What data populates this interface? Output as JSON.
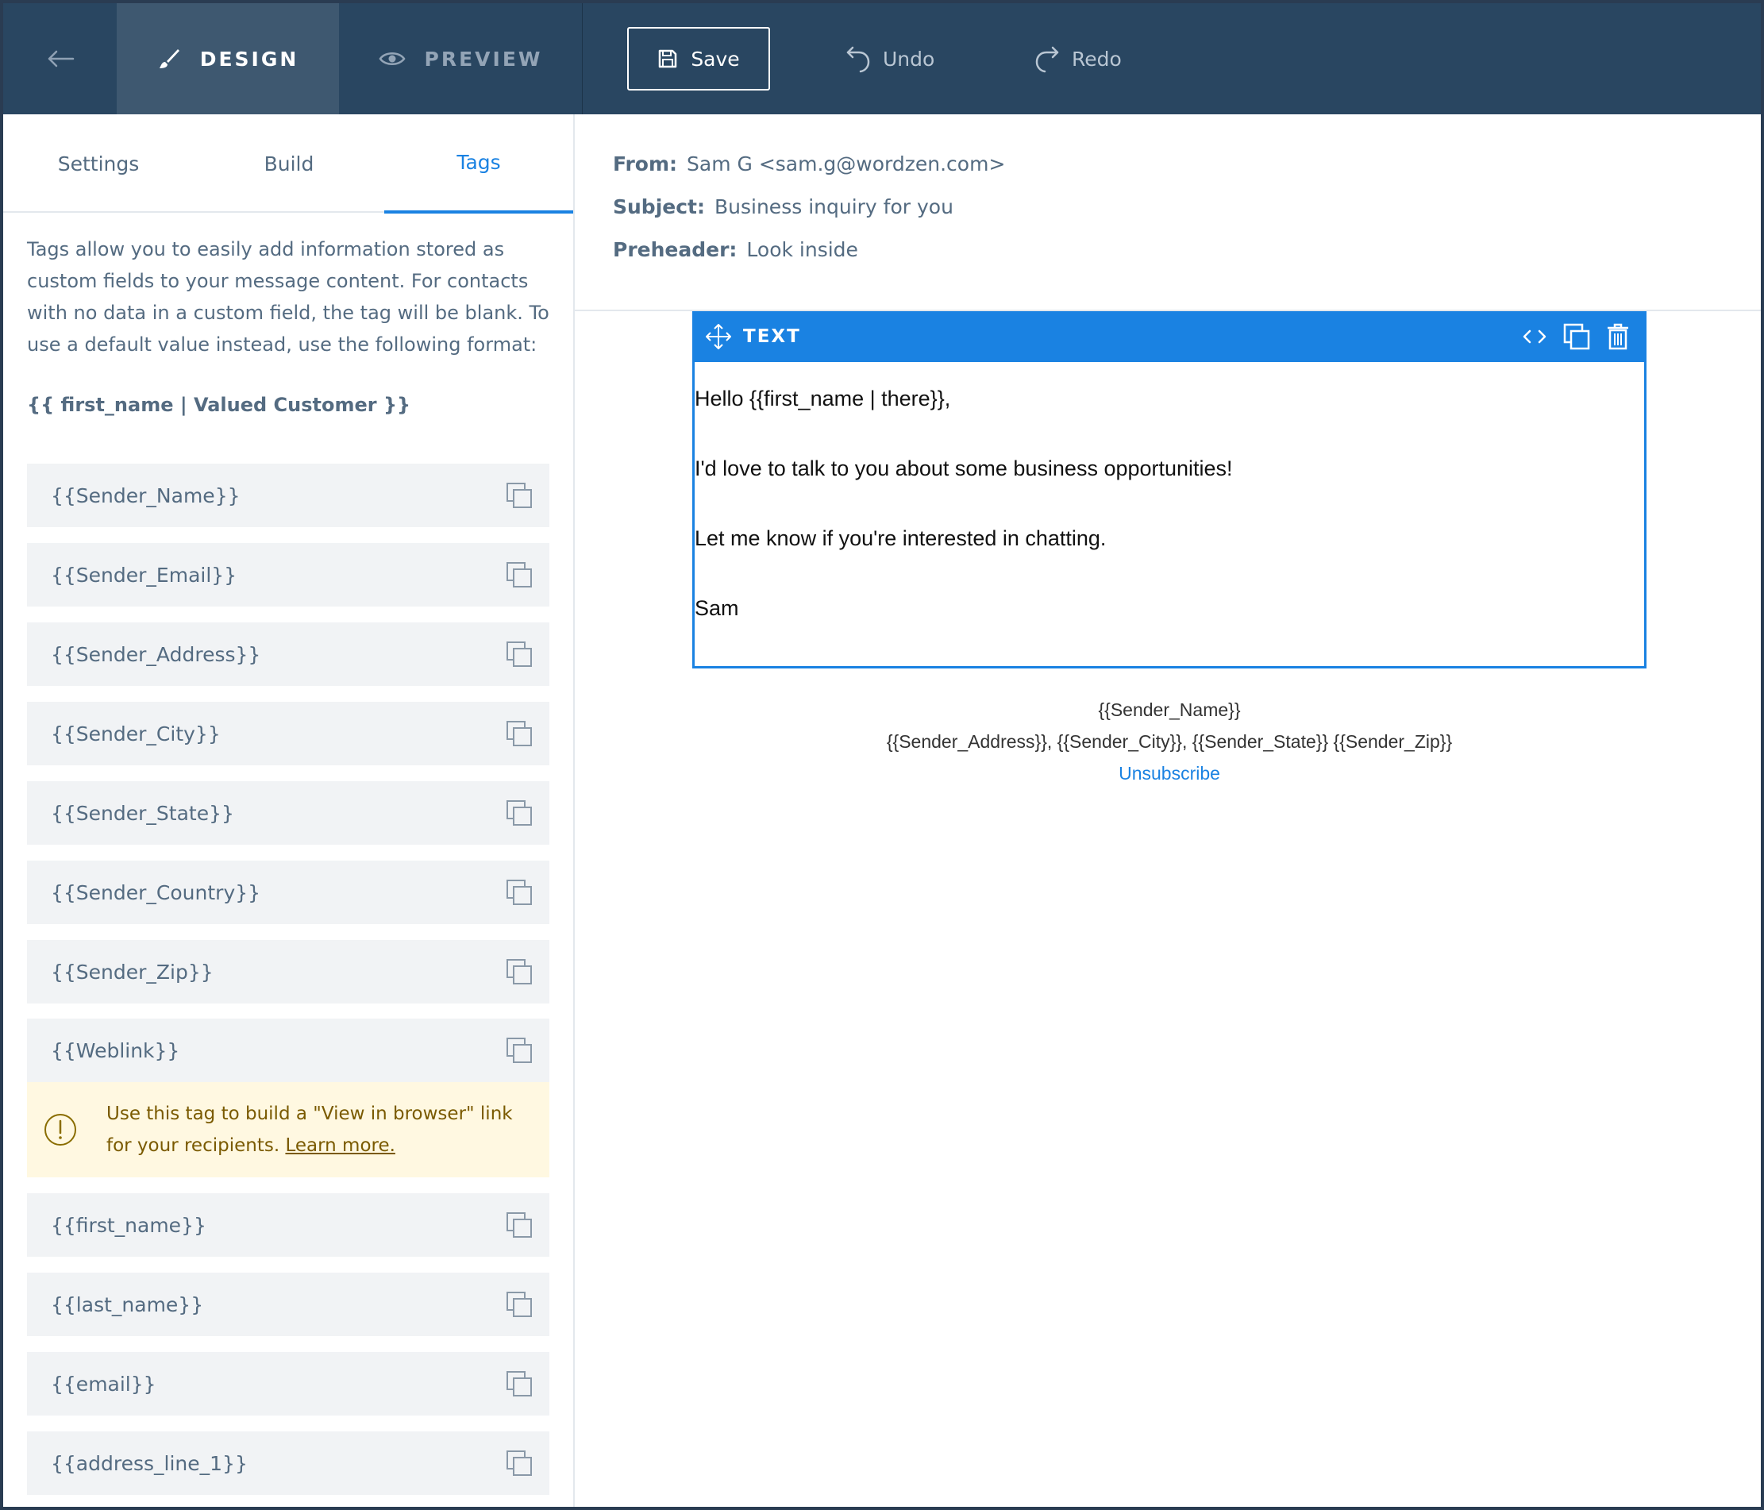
{
  "topbar": {
    "design_label": "DESIGN",
    "preview_label": "PREVIEW",
    "save_label": "Save",
    "undo_label": "Undo",
    "redo_label": "Redo"
  },
  "left_panel": {
    "tabs": [
      {
        "label": "Settings",
        "active": false
      },
      {
        "label": "Build",
        "active": false
      },
      {
        "label": "Tags",
        "active": true
      }
    ],
    "intro_text": "Tags allow you to easily add information stored as custom fields to your message content. For contacts with no data in a custom field, the tag will be blank. To use a default value instead, use the following format:",
    "format_example": "{{ first_name | Valued Customer }}",
    "tags": [
      "{{Sender_Name}}",
      "{{Sender_Email}}",
      "{{Sender_Address}}",
      "{{Sender_City}}",
      "{{Sender_State}}",
      "{{Sender_Country}}",
      "{{Sender_Zip}}",
      "{{Weblink}}",
      "{{first_name}}",
      "{{last_name}}",
      "{{email}}",
      "{{address_line_1}}"
    ],
    "weblink_note": {
      "text": "Use this tag to build a \"View in browser\" link for your recipients.",
      "link": "Learn more."
    }
  },
  "email_header": {
    "from_label": "From:",
    "from_value": "Sam G <sam.g@wordzen.com>",
    "subject_label": "Subject:",
    "subject_value": "Business inquiry for you",
    "preheader_label": "Preheader:",
    "preheader_value": "Look inside"
  },
  "text_block": {
    "label": "TEXT",
    "lines": [
      "Hello {{first_name | there}},",
      "I'd love to talk to you about some business opportunities!",
      "Let me know if you're interested in chatting.",
      "Sam"
    ]
  },
  "footer": {
    "line1": "{{Sender_Name}}",
    "line2": "{{Sender_Address}}, {{Sender_City}}, {{Sender_State}} {{Sender_Zip}}",
    "unsubscribe": "Unsubscribe"
  },
  "colors": {
    "topbar": "#294661",
    "design_tab_active": "#3e5870",
    "accent": "#1a82e2",
    "note_bg": "#fff8e1"
  }
}
